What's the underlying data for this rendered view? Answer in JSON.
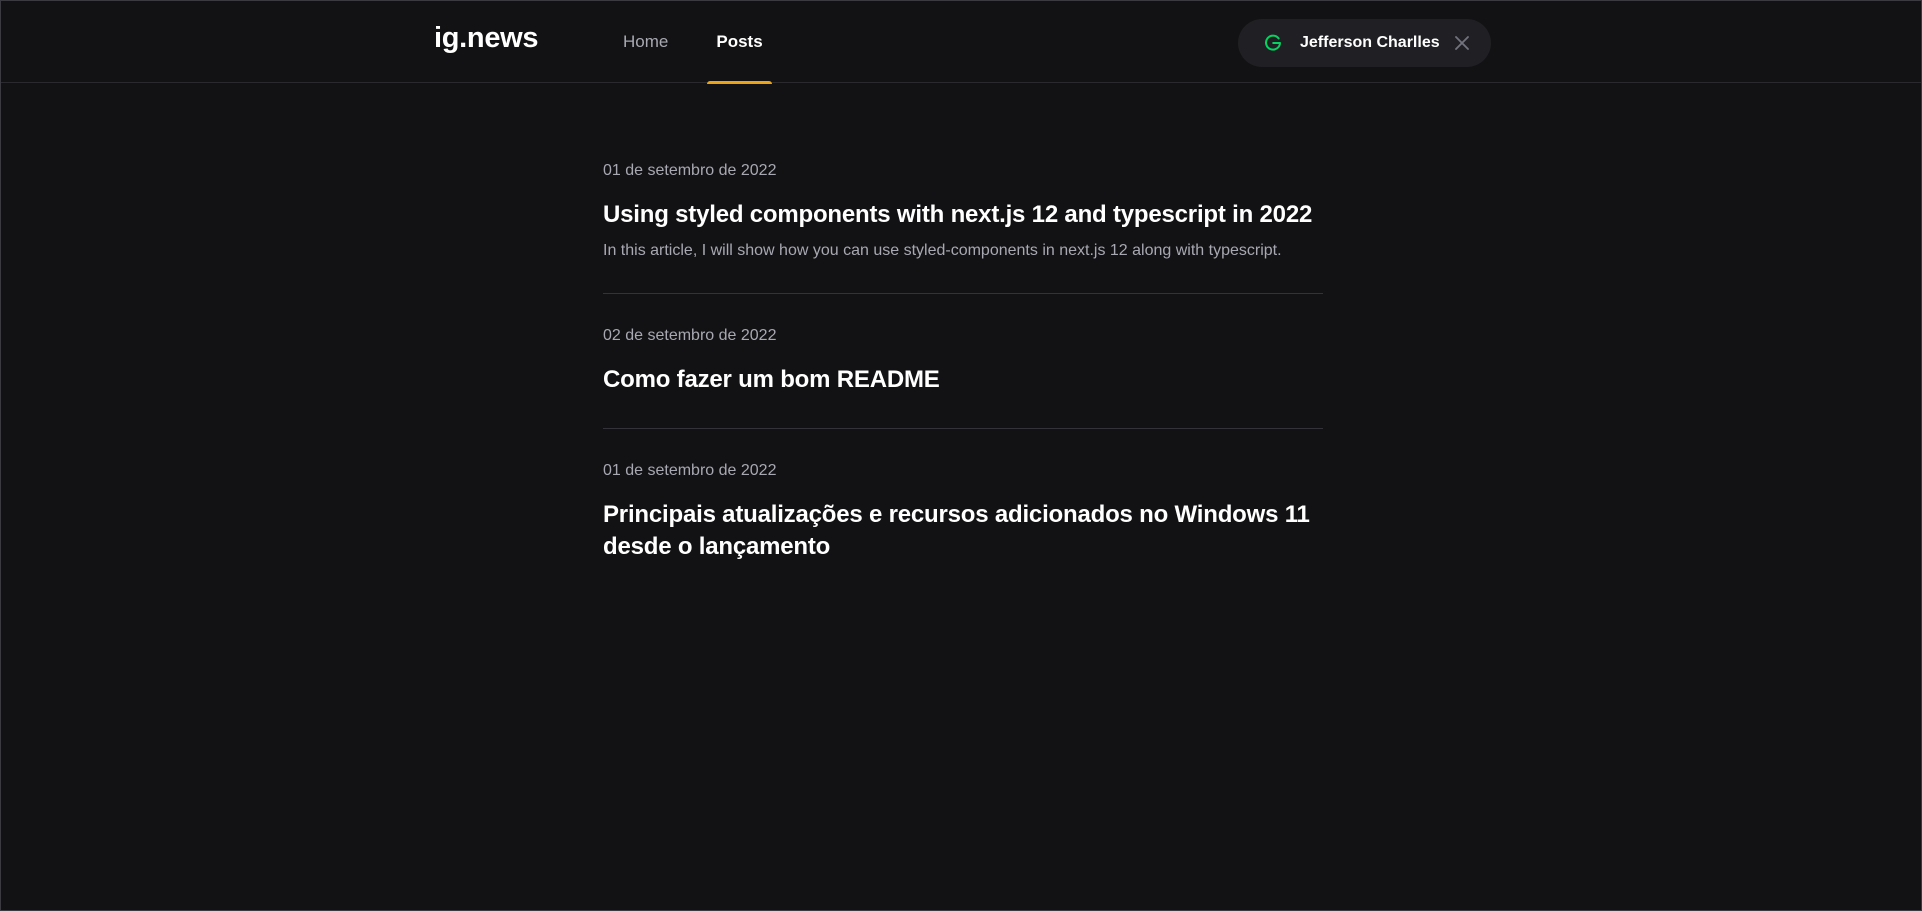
{
  "header": {
    "logo": "ig.news",
    "nav": [
      {
        "label": "Home",
        "active": false
      },
      {
        "label": "Posts",
        "active": true
      }
    ],
    "user": {
      "icon": "google-icon",
      "name": "Jefferson Charlles",
      "close_icon": "close-icon"
    }
  },
  "colors": {
    "background": "#121214",
    "accent": "#eba417",
    "google_green": "#04d361",
    "text_muted": "#a8a8b3",
    "pill_bg": "#202024"
  },
  "posts": [
    {
      "date": "01 de setembro de 2022",
      "title": "Using styled components with next.js 12 and typescript in 2022",
      "excerpt": "In this article, I will show how you can use styled-components in next.js 12 along with typescript."
    },
    {
      "date": "02 de setembro de 2022",
      "title": "Como fazer um bom README",
      "excerpt": ""
    },
    {
      "date": "01 de setembro de 2022",
      "title": "Principais atualizações e recursos adicionados no Windows 11 desde o lançamento",
      "excerpt": ""
    }
  ]
}
